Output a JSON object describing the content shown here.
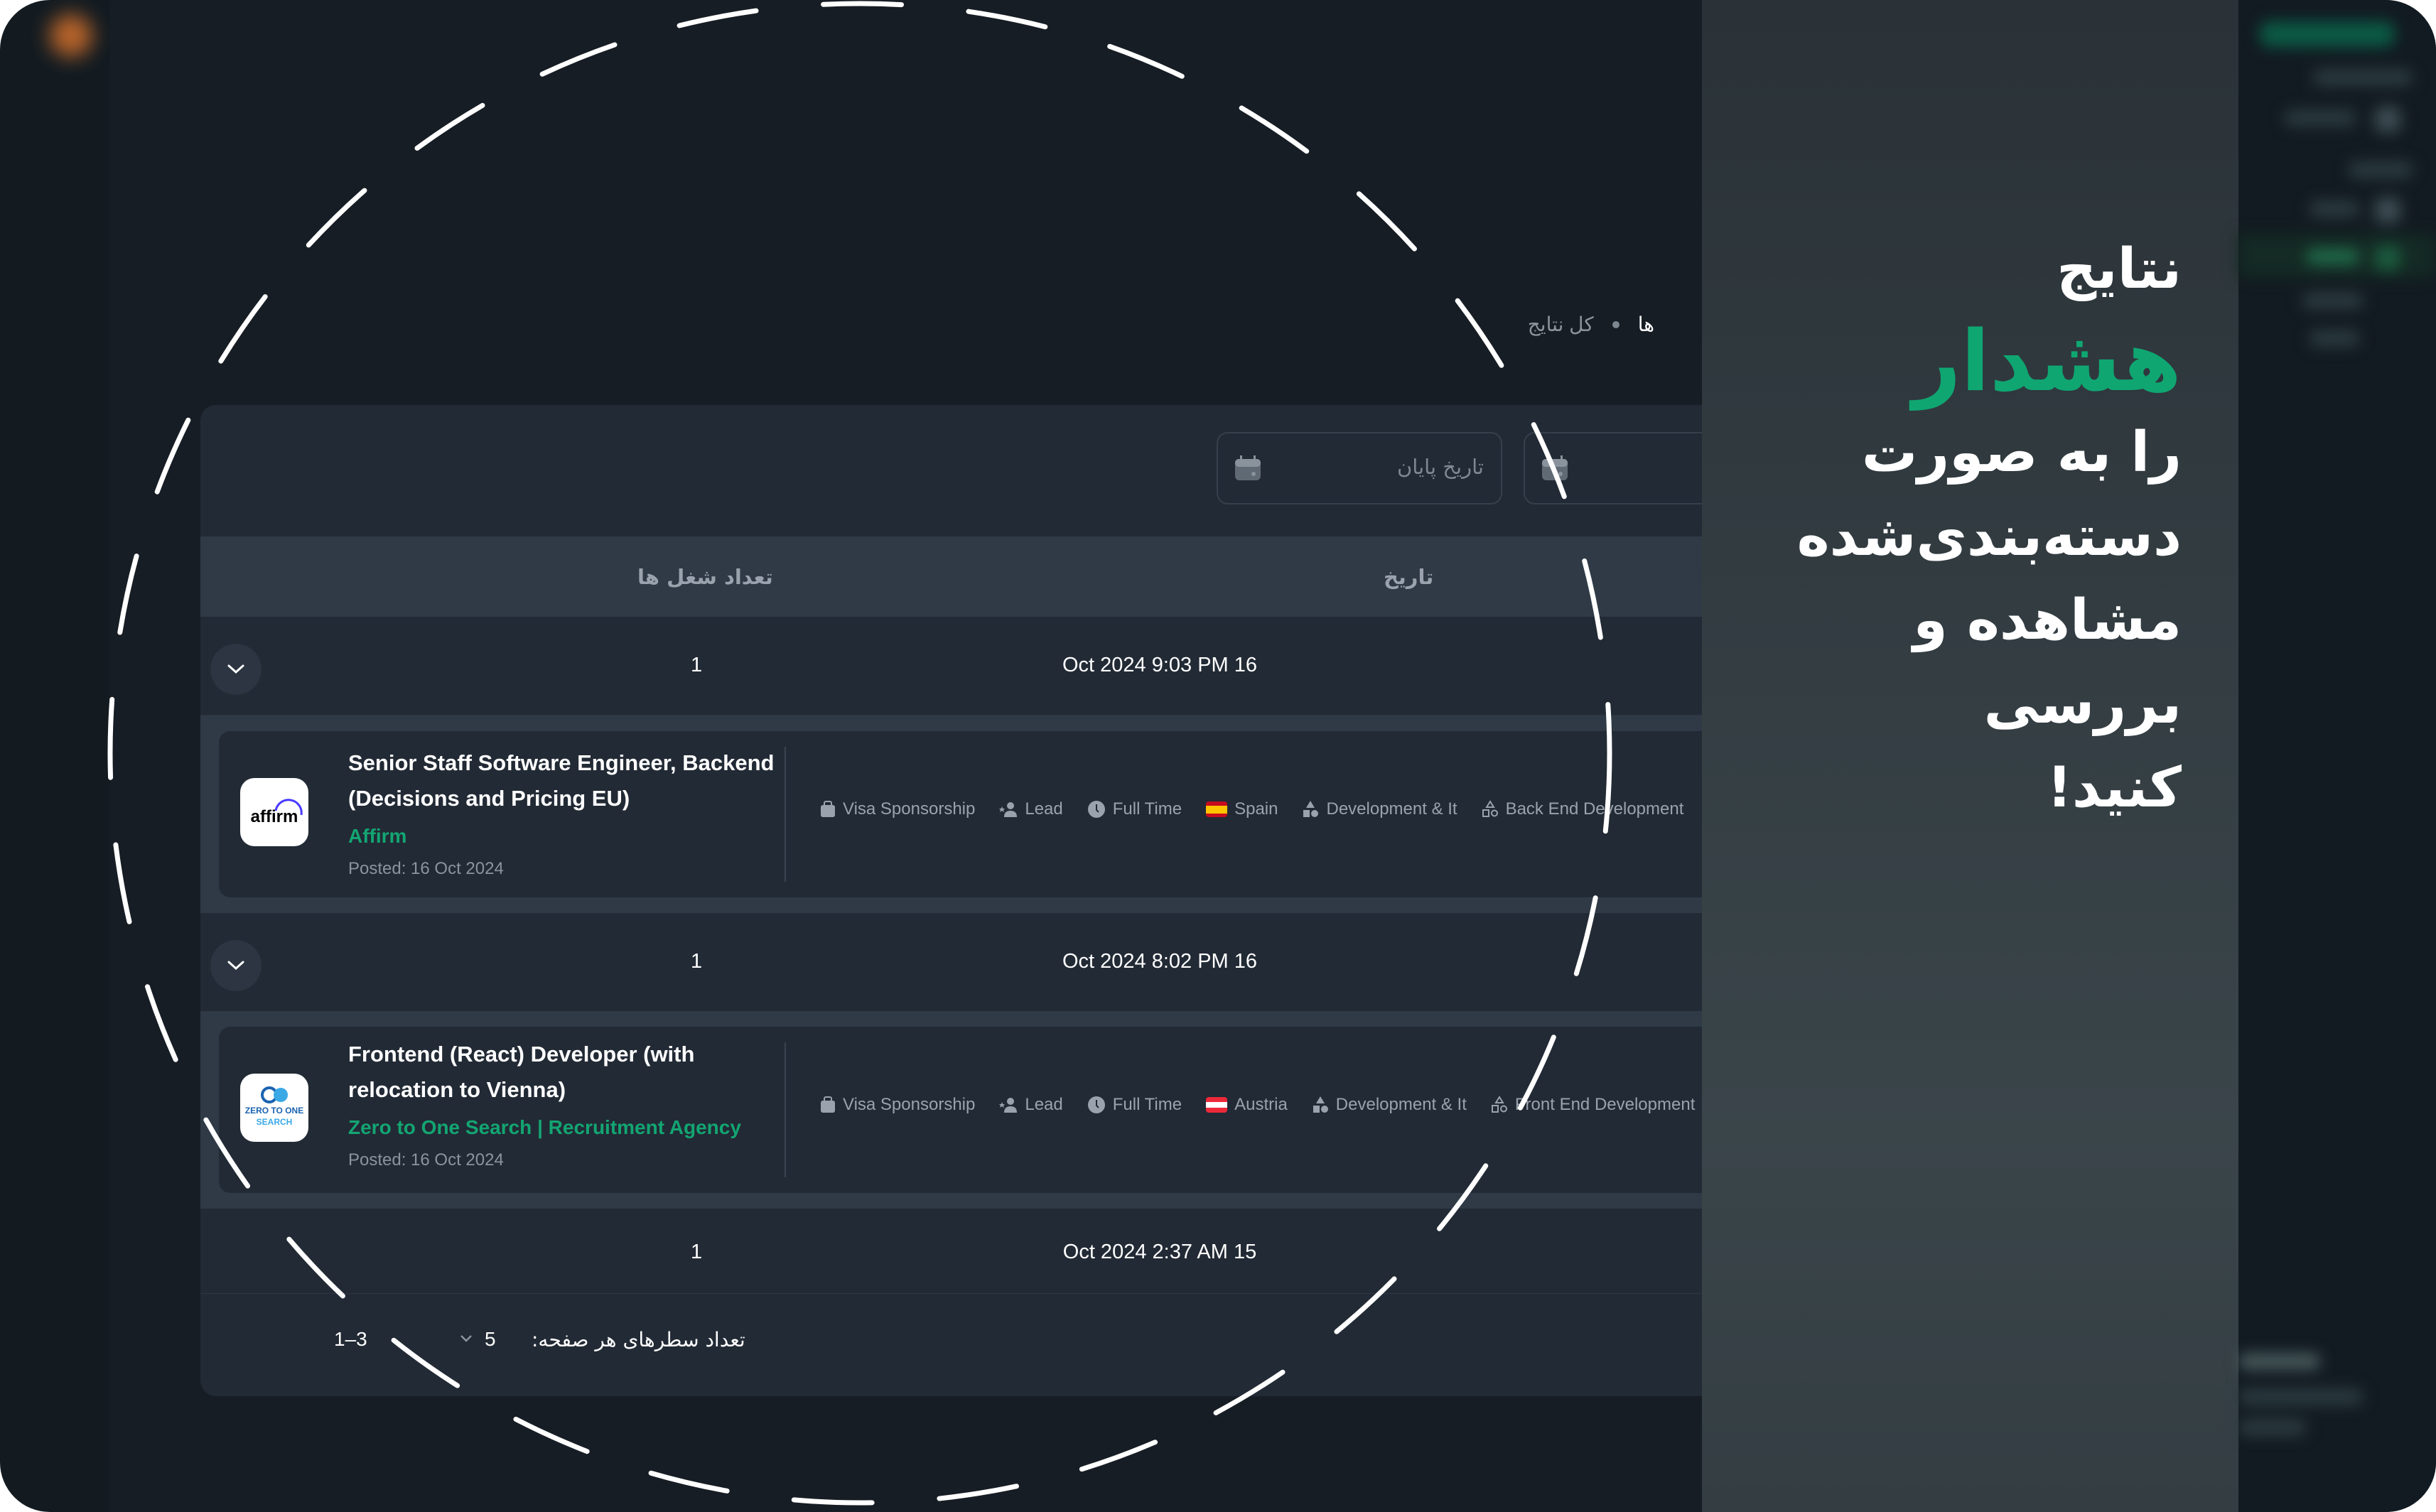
{
  "breadcrumb": {
    "current": "ها",
    "link": "کل نتایج"
  },
  "filters": {
    "end_date_placeholder": "تاریخ پایان",
    "start_date_placeholder": ""
  },
  "table": {
    "headers": {
      "date": "تاریخ",
      "job_count": "تعداد شغل ها"
    },
    "groups": [
      {
        "date": "Oct 2024 9:03 PM 16",
        "count": "1",
        "job": {
          "title": "Senior Staff Software Engineer, Backend (Decisions and Pricing EU)",
          "company": "Affirm",
          "posted": "Posted: 16 Oct 2024",
          "logo_text": "affirm",
          "tags": [
            {
              "icon": "briefcase-icon",
              "label": "Visa Sponsorship"
            },
            {
              "icon": "user-star-icon",
              "label": "Lead"
            },
            {
              "icon": "clock-icon",
              "label": "Full Time"
            },
            {
              "icon": "flag-spain-icon",
              "label": "Spain"
            },
            {
              "icon": "shapes-icon",
              "label": "Development & It"
            },
            {
              "icon": "shapes-outline-icon",
              "label": "Back End Development"
            }
          ]
        }
      },
      {
        "date": "Oct 2024 8:02 PM 16",
        "count": "1",
        "job": {
          "title": "Frontend (React) Developer (with relocation to Vienna)",
          "company": "Zero to One Search | Recruitment Agency",
          "posted": "Posted: 16 Oct 2024",
          "logo_text_line1": "ZERO TO ONE",
          "logo_text_line2": "SEARCH",
          "tags": [
            {
              "icon": "briefcase-icon",
              "label": "Visa Sponsorship"
            },
            {
              "icon": "user-star-icon",
              "label": "Lead"
            },
            {
              "icon": "clock-icon",
              "label": "Full Time"
            },
            {
              "icon": "flag-austria-icon",
              "label": "Austria"
            },
            {
              "icon": "shapes-icon",
              "label": "Development & It"
            },
            {
              "icon": "shapes-outline-icon",
              "label": "Front End Development"
            }
          ]
        }
      },
      {
        "date": "Oct 2024 2:37 AM 15",
        "count": "1"
      }
    ]
  },
  "pagination": {
    "rows_per_page_label": "تعداد سطرهای هر صفحه:",
    "rows_per_page_value": "5",
    "range": "1–3"
  },
  "promo": {
    "line1": "نتایج",
    "accent": "هشدار",
    "line2": "را به صورت",
    "line3": "دسته‌بندی‌شده",
    "line4": "مشاهده و بررسی",
    "line5": "کنید!"
  },
  "colors": {
    "accent": "#0fa672",
    "panel": "#222a35",
    "header": "#2f3a46"
  }
}
